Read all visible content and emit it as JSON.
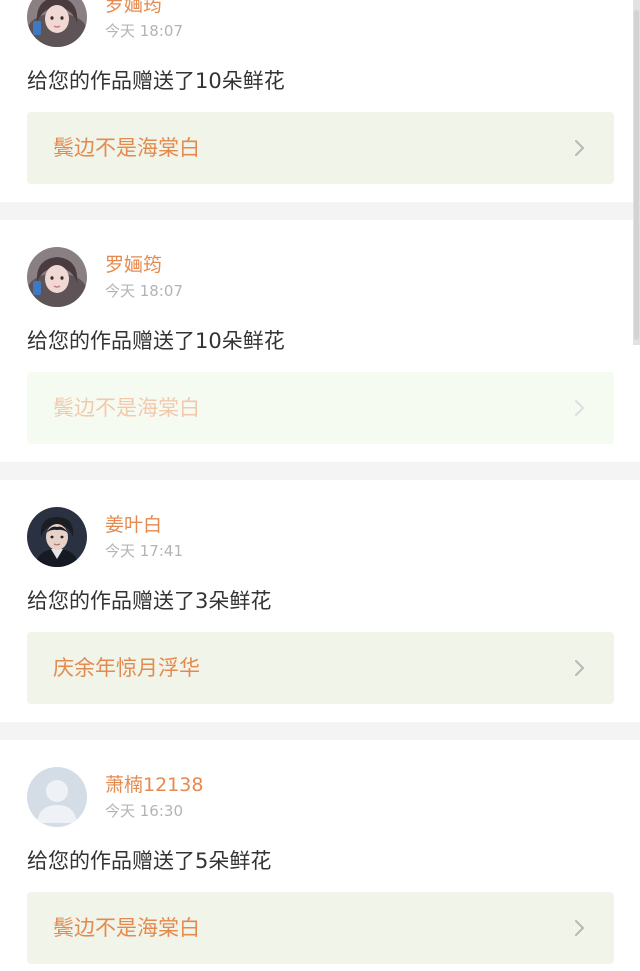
{
  "theme": {
    "accent": "#e58a4f",
    "link_background": "#f1f4e8",
    "timestamp_color": "#b4b4b4",
    "message_color": "#333333"
  },
  "notifications": [
    {
      "user_name": "罗婳筠",
      "timestamp": "今天 18:07",
      "message": "给您的作品赠送了10朵鲜花",
      "work_title": "鬓边不是海棠白",
      "avatar_icon": "girl-avatar-icon",
      "link_icon": "chevron-right-icon"
    },
    {
      "user_name": "罗婳筠",
      "timestamp": "今天 18:07",
      "message": "给您的作品赠送了10朵鲜花",
      "work_title": "鬓边不是海棠白",
      "avatar_icon": "girl-avatar-icon",
      "link_icon": "chevron-right-icon"
    },
    {
      "user_name": "姜叶白",
      "timestamp": "今天 17:41",
      "message": "给您的作品赠送了3朵鲜花",
      "work_title": "庆余年惊月浮华",
      "avatar_icon": "boy-avatar-icon",
      "link_icon": "chevron-right-icon"
    },
    {
      "user_name": "萧楠12138",
      "timestamp": "今天 16:30",
      "message": "给您的作品赠送了5朵鲜花",
      "work_title": "鬓边不是海棠白",
      "avatar_icon": "default-avatar-icon",
      "link_icon": "chevron-right-icon"
    }
  ]
}
